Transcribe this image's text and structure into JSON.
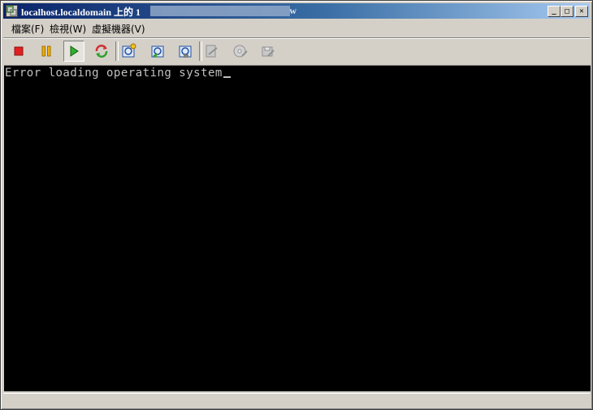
{
  "window": {
    "title": "localhost.localdomain 上的 1",
    "redacted_title_suffix": "w"
  },
  "menu": {
    "items": [
      {
        "label": "檔案(F)"
      },
      {
        "label": "檢視(W)"
      },
      {
        "label": "虛擬機器(V)"
      }
    ]
  },
  "toolbar": {
    "buttons": [
      {
        "name": "power-off",
        "icon": "stop-icon",
        "color": "#e02020"
      },
      {
        "name": "suspend",
        "icon": "pause-icon",
        "color": "#e0a000"
      },
      {
        "name": "power-on",
        "icon": "play-icon",
        "color": "#20a020",
        "pressed": true
      },
      {
        "name": "reset",
        "icon": "refresh-icon",
        "color": "#d03030"
      },
      {
        "name": "snapshot",
        "icon": "snapshot-icon"
      },
      {
        "name": "revert-snapshot",
        "icon": "revert-snapshot-icon"
      },
      {
        "name": "snapshot-manager",
        "icon": "snapshot-manager-icon"
      },
      {
        "name": "edit-settings",
        "icon": "edit-settings-icon",
        "disabled": true
      },
      {
        "name": "cd-dvd",
        "icon": "cd-icon",
        "disabled": true
      },
      {
        "name": "floppy",
        "icon": "floppy-icon",
        "disabled": true
      }
    ]
  },
  "console": {
    "text": "Error loading operating system"
  }
}
